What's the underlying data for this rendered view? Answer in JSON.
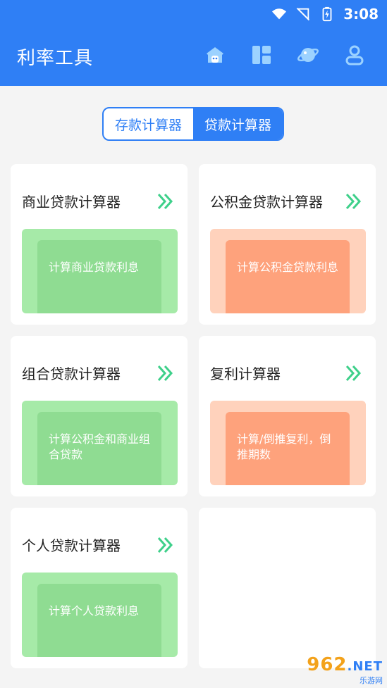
{
  "statusbar": {
    "time": "3:08"
  },
  "app": {
    "title": "利率工具"
  },
  "toolbar": {
    "icons": [
      "home-icon",
      "grid-icon",
      "planet-icon",
      "user-icon"
    ]
  },
  "tabs": [
    {
      "label": "存款计算器",
      "active": false
    },
    {
      "label": "贷款计算器",
      "active": true
    }
  ],
  "cards": [
    {
      "title": "商业贷款计算器",
      "desc": "计算商业贷款利息",
      "color": "green"
    },
    {
      "title": "公积金贷款计算器",
      "desc": "计算公积金贷款利息",
      "color": "orange"
    },
    {
      "title": "组合贷款计算器",
      "desc": "计算公积金和商业组合贷款",
      "color": "green"
    },
    {
      "title": "复利计算器",
      "desc": "计算/倒推复利，倒推期数",
      "color": "orange"
    },
    {
      "title": "个人贷款计算器",
      "desc": "计算个人贷款利息",
      "color": "green"
    }
  ],
  "watermark": {
    "text": "962",
    "net": ".NET",
    "sub": "乐游网"
  },
  "colors": {
    "primary": "#2f7ff5",
    "green_band": "#a6eaa8",
    "green_inner": "#8fdc92",
    "orange_band": "#ffd2bc",
    "orange_inner": "#fea27c",
    "chevron": "#3ed08a"
  }
}
